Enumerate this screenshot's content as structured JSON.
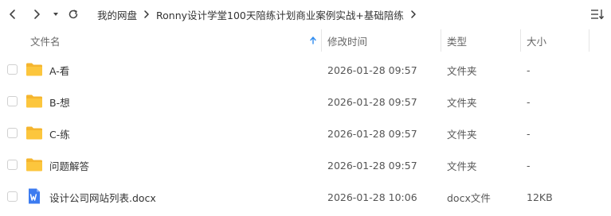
{
  "toolbar": {
    "breadcrumb": [
      "我的网盘",
      "Ronny设计学堂100天陪练计划商业案例实战+基础陪练"
    ],
    "icons": [
      "back-icon",
      "forward-icon",
      "dropdown-icon",
      "refresh-icon",
      "sort-menu-icon"
    ]
  },
  "columns": {
    "name": "文件名",
    "modified": "修改时间",
    "type": "类型",
    "size": "大小"
  },
  "files": [
    {
      "name": "A-看",
      "modified": "2026-01-28 09:57",
      "type": "文件夹",
      "size": "-",
      "icon": "folder-icon"
    },
    {
      "name": "B-想",
      "modified": "2026-01-28 09:57",
      "type": "文件夹",
      "size": "-",
      "icon": "folder-icon"
    },
    {
      "name": "C-练",
      "modified": "2026-01-28 09:57",
      "type": "文件夹",
      "size": "-",
      "icon": "folder-icon"
    },
    {
      "name": "问题解答",
      "modified": "2026-01-28 09:57",
      "type": "文件夹",
      "size": "-",
      "icon": "folder-icon"
    },
    {
      "name": "设计公司网站列表.docx",
      "modified": "2026-01-28 10:06",
      "type": "docx文件",
      "size": "12KB",
      "icon": "word-doc-icon"
    }
  ],
  "colors": {
    "folder": "#F5B52E",
    "word": "#3C7BF0",
    "sort_arrow": "#2F8CF0",
    "divider": "#E6E6E6"
  }
}
